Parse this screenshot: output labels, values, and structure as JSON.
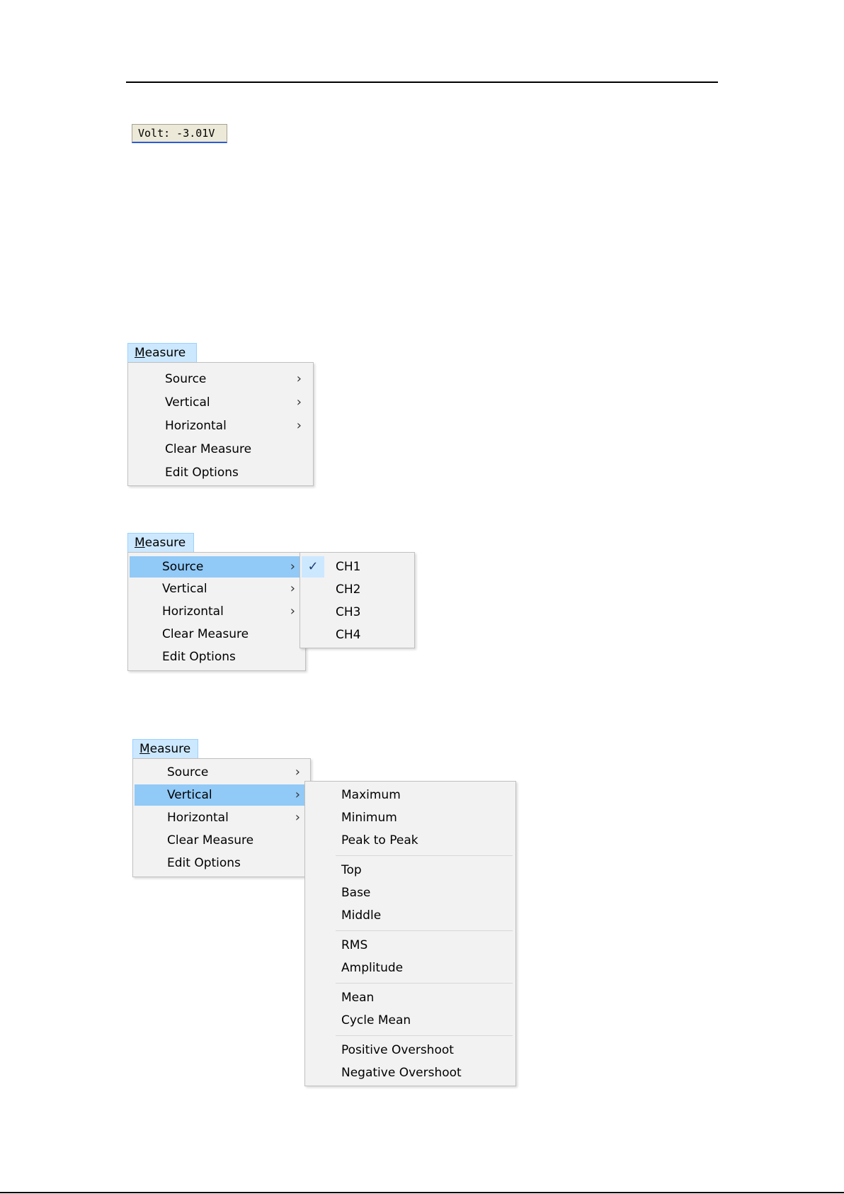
{
  "volt_display": "Volt: -3.01V",
  "menu": {
    "title_mnemonic": "M",
    "title_rest": "easure",
    "items": [
      "Source",
      "Vertical",
      "Horizontal",
      "Clear Measure",
      "Edit Options"
    ],
    "submenu_arrow": "›"
  },
  "source_submenu": {
    "items": [
      "CH1",
      "CH2",
      "CH3",
      "CH4"
    ],
    "checked": "CH1",
    "check_glyph": "✓"
  },
  "vertical_submenu": {
    "groups": [
      [
        "Maximum",
        "Minimum",
        "Peak to Peak"
      ],
      [
        "Top",
        "Base",
        "Middle"
      ],
      [
        "RMS",
        "Amplitude"
      ],
      [
        "Mean",
        "Cycle Mean"
      ],
      [
        "Positive Overshoot",
        "Negative Overshoot"
      ]
    ]
  }
}
